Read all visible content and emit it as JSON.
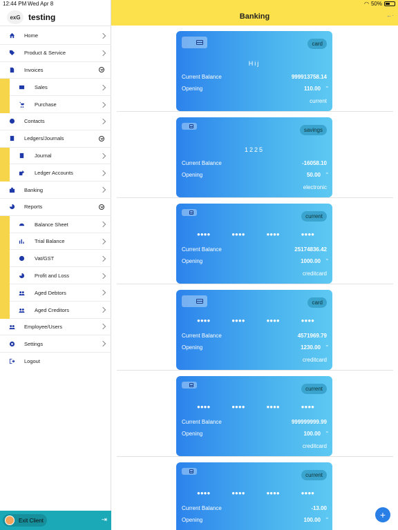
{
  "status": {
    "time": "12:44 PM",
    "date": "Wed Apr 8",
    "battery": "50%"
  },
  "sidebar": {
    "logo_text": "exG",
    "title": "testing",
    "items": [
      {
        "label": "Home",
        "icon": "home-icon"
      },
      {
        "label": "Product & Service",
        "icon": "tag-icon"
      },
      {
        "label": "Invoices",
        "icon": "document-icon"
      },
      {
        "label": "Sales",
        "icon": "card-icon"
      },
      {
        "label": "Purchase",
        "icon": "cart-icon"
      },
      {
        "label": "Contacts",
        "icon": "contacts-icon"
      },
      {
        "label": "Ledgers/Journals",
        "icon": "ledger-icon"
      },
      {
        "label": "Journal",
        "icon": "book-icon"
      },
      {
        "label": "Ledger Accounts",
        "icon": "edit-icon"
      },
      {
        "label": "Banking",
        "icon": "briefcase-icon"
      },
      {
        "label": "Reports",
        "icon": "pie-icon"
      },
      {
        "label": "Balance Sheet",
        "icon": "gauge-icon"
      },
      {
        "label": "Trial Balance",
        "icon": "bar-chart-icon"
      },
      {
        "label": "Vat/GST",
        "icon": "percent-icon"
      },
      {
        "label": "Profit and Loss",
        "icon": "pie-icon"
      },
      {
        "label": "Aged Debtors",
        "icon": "users-icon"
      },
      {
        "label": "Aged Creditors",
        "icon": "users-icon"
      },
      {
        "label": "Employee/Users",
        "icon": "users-icon"
      },
      {
        "label": "Settings",
        "icon": "gear-icon"
      },
      {
        "label": "Logout",
        "icon": "logout-icon"
      }
    ],
    "footer": {
      "exit_label": "Exit Client"
    }
  },
  "header": {
    "title": "Banking"
  },
  "labels": {
    "current_balance": "Current Balance",
    "opening": "Opening"
  },
  "accounts": [
    {
      "badge": "card",
      "number": "Hij",
      "masked": false,
      "balance": "999913758.14",
      "opening": "110.00",
      "type": "current"
    },
    {
      "badge": "savings",
      "number": "1225",
      "masked": false,
      "balance": "-16058.10",
      "opening": "50.00",
      "type": "electronic"
    },
    {
      "badge": "current",
      "number": "",
      "masked": true,
      "balance": "25174836.42",
      "opening": "1000.00",
      "type": "creditcard"
    },
    {
      "badge": "card",
      "number": "",
      "masked": true,
      "balance": "4571969.79",
      "opening": "1230.00",
      "type": "creditcard"
    },
    {
      "badge": "current",
      "number": "",
      "masked": true,
      "balance": "999999999.99",
      "opening": "100.00",
      "type": "creditcard"
    },
    {
      "badge": "current",
      "number": "",
      "masked": true,
      "balance": "-13.00",
      "opening": "100.00",
      "type": ""
    }
  ]
}
